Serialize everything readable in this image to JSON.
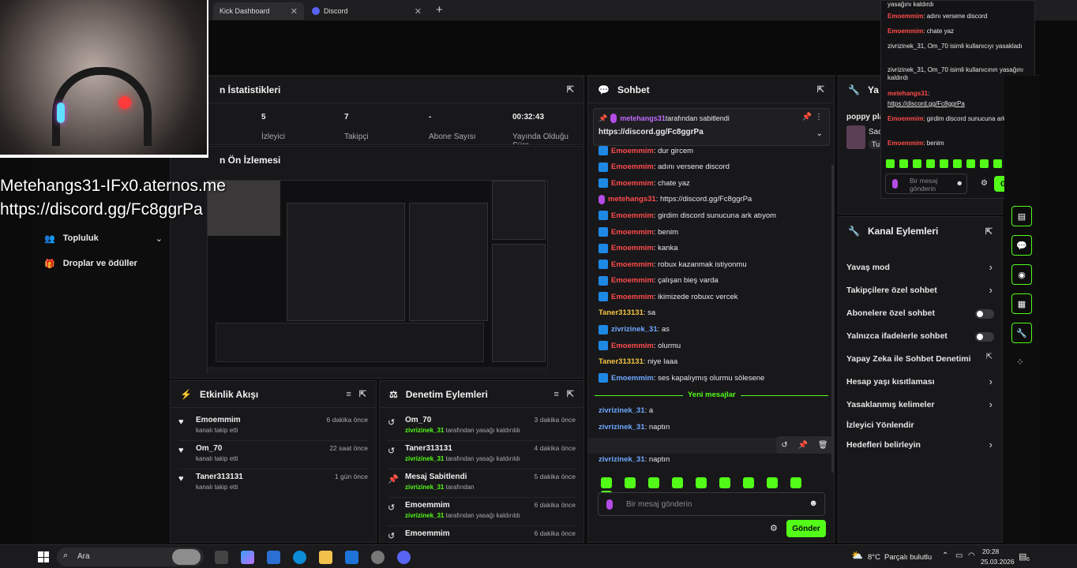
{
  "browser": {
    "tabs": [
      {
        "label": "Kick Dashboard"
      },
      {
        "label": "Discord"
      }
    ],
    "new_tab": "+"
  },
  "overlay": {
    "line1": "Metehangs31-IFx0.aternos.me",
    "line2": "https://discord.gg/Fc8ggrPa"
  },
  "sidebar": {
    "items": [
      {
        "label": "Topluluk"
      },
      {
        "label": "Droplar ve ödüller"
      }
    ]
  },
  "stats": {
    "title": "n İstatistikleri",
    "items": [
      {
        "value": "5",
        "label": "İzleyici"
      },
      {
        "value": "7",
        "label": "Takipçi"
      },
      {
        "value": "-",
        "label": "Abone Sayısı"
      },
      {
        "value": "00:32:43",
        "label": "Yayında Olduğu Süre"
      }
    ]
  },
  "preview": {
    "title": "n Ön İzlemesi"
  },
  "activity": {
    "title": "Etkinlik Akışı",
    "items": [
      {
        "name": "Emoemmim",
        "sub": "kanalı takip etti",
        "time": "6 dakika önce"
      },
      {
        "name": "Om_70",
        "sub": "kanalı takip etti",
        "time": "22 saat önce"
      },
      {
        "name": "Taner313131",
        "sub": "kanalı takip etti",
        "time": "1 gün önce"
      }
    ]
  },
  "moderation": {
    "title": "Denetim Eylemleri",
    "items": [
      {
        "name": "Om_70",
        "who": "zivrizinek_31",
        "sub": " tarafından yasağı kaldırıldı",
        "time": "3 dakika önce"
      },
      {
        "name": "Taner313131",
        "who": "zivrizinek_31",
        "sub": " tarafından yasağı kaldırıldı",
        "time": "4 dakika önce"
      },
      {
        "name": "Mesaj Sabitlendi",
        "who": "zivrizinek_31",
        "sub": " tarafından",
        "time": "5 dakika önce"
      },
      {
        "name": "Emoemmim",
        "who": "zivrizinek_31",
        "sub": " tarafından yasağı kaldırıldı",
        "time": "6 dakika önce"
      },
      {
        "name": "Emoemmim",
        "who": "",
        "sub": "",
        "time": "6 dakika önce"
      }
    ]
  },
  "chat": {
    "title": "Sohbet",
    "pinned": {
      "by": "metehangs31",
      "by_suffix": " tarafından sabitlendi",
      "link": "https://discord.gg/Fc8ggrPa"
    },
    "messages": [
      {
        "user": "Emoemmim",
        "text": ": dur gircem",
        "color": "red",
        "badge": "kick"
      },
      {
        "user": "Emoemmim",
        "text": ": adını versene discord",
        "color": "red",
        "badge": "kick"
      },
      {
        "user": "Emoemmim",
        "text": ": chate yaz",
        "color": "red",
        "badge": "kick"
      },
      {
        "user": "metehangs31",
        "text": ": https://discord.gg/Fc8ggrPa",
        "color": "red",
        "badge": "mic"
      },
      {
        "user": "Emoemmim",
        "text": ": girdim discord sunucuna ark atıyom",
        "color": "red",
        "badge": "kick"
      },
      {
        "user": "Emoemmim",
        "text": ": benim",
        "color": "red",
        "badge": "kick"
      },
      {
        "user": "Emoemmim",
        "text": ": kanka",
        "color": "red",
        "badge": "kick"
      },
      {
        "user": "Emoemmim",
        "text": ": robux kazanmak istiyonmu",
        "color": "red",
        "badge": "kick"
      },
      {
        "user": "Emoemmim",
        "text": ": çalışan bieş varda",
        "color": "red",
        "badge": "kick"
      },
      {
        "user": "Emoemmim",
        "text": ": ikimizede robuxc vercek",
        "color": "red",
        "badge": "kick"
      },
      {
        "user": "Taner313131",
        "text": ": sa",
        "color": "yellow",
        "badge": ""
      },
      {
        "user": "zivrizinek_31",
        "text": ": as",
        "color": "blue",
        "badge": "kick"
      },
      {
        "user": "Emoemmim",
        "text": ": olurmu",
        "color": "red",
        "badge": "kick"
      },
      {
        "user": "Taner313131",
        "text": ": niye laaa",
        "color": "yellow",
        "badge": ""
      },
      {
        "user": "Emoemmim",
        "text": ": ses kapalıymış olurmu sölesene",
        "color": "blue",
        "badge": "kick"
      }
    ],
    "new_messages_label": "Yeni mesajlar",
    "new_messages": [
      {
        "user": "zivrizinek_31",
        "text": ": a"
      },
      {
        "user": "zivrizinek_31",
        "text": ": naptın"
      },
      {
        "user": "zivrizinek_31",
        "text": ":"
      },
      {
        "user": "zivrizinek_31",
        "text": ": naptın"
      }
    ],
    "input_placeholder": "Bir mesaj gönderin",
    "send_label": "Gönder"
  },
  "mini_chat": {
    "lines": [
      {
        "user": "",
        "text": "yasağını kaldırdı"
      },
      {
        "user": "Emoemmim",
        "text": ": adını versene discord"
      },
      {
        "user": "Emoemmim",
        "text": ": chate yaz"
      },
      {
        "user": "",
        "text": "zivrizinek_31, Om_70 isimli kullanıcıyı yasakladı"
      },
      {
        "user": "",
        "text": "zivrizinek_31, Om_70 isimli kullanıcının yasağını kaldırdı"
      },
      {
        "user": "metehangs31",
        "text": ":"
      },
      {
        "user": "",
        "text": "https://discord.gg/Fc8ggrPa"
      },
      {
        "user": "Emoemmim",
        "text": ": girdim discord sunucuna ark atıyom"
      },
      {
        "user": "Emoemmim",
        "text": ": benim"
      }
    ],
    "input_placeholder": "Bir mesaj gönderin",
    "send_label": "Gönder"
  },
  "yayin": {
    "title": "Ya",
    "line1": "poppy pla",
    "line2": "Sac",
    "line3": "Tu"
  },
  "channel_actions": {
    "title": "Kanal Eylemleri",
    "items": [
      {
        "label": "Yavaş mod",
        "control": "arrow"
      },
      {
        "label": "Takipçilere özel sohbet",
        "control": "arrow"
      },
      {
        "label": "Abonelere özel sohbet",
        "control": "toggle"
      },
      {
        "label": "Yalnızca ifadelerle sohbet",
        "control": "toggle"
      },
      {
        "label": "Yapay Zeka ile Sohbet Denetimi",
        "control": "external"
      },
      {
        "label": "Hesap yaşı kısıtlaması",
        "control": "arrow"
      },
      {
        "label": "Yasaklanmış kelimeler",
        "control": "arrow"
      },
      {
        "label": "İzleyici Yönlendir",
        "control": "none"
      },
      {
        "label": "Hedefleri belirleyin",
        "control": "arrow"
      }
    ]
  },
  "taskbar": {
    "search": "Ara",
    "weather_temp": "8°C",
    "weather_text": "Parçalı bulutlu",
    "time": "20:28",
    "date": "25.03.2026",
    "notif": "6"
  },
  "colors": {
    "accent": "#53fc18",
    "panel": "#18181b",
    "bg": "#0b0b0c"
  }
}
